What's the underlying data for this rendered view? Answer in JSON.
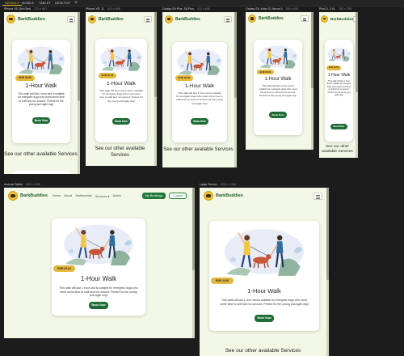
{
  "toolbar": {
    "tabs": [
      "DEFAULT",
      "MOBILE",
      "TABLET",
      "DESKTOP"
    ],
    "add_label": "+"
  },
  "site": {
    "brand": "BarkBuddies",
    "nav": {
      "home": "Home",
      "about": "About",
      "testimonials": "Testimonials",
      "services": "Services",
      "admin": "Admin",
      "bookings": "My Bookings",
      "logout": "Logout"
    },
    "card": {
      "price": "EUR 20.00",
      "title": "1-Hour Walk",
      "description": "This walk will last 1 hour and is suitable for energetic dogs who need some time to sniff and run around. Perfect for the young and agile dog!",
      "button": "Book Now"
    },
    "see_more": "See our other available Services"
  },
  "devices": [
    {
      "name": "iPhone SE (3rd Gen)",
      "size": "375 x 667"
    },
    {
      "name": "iPhone XR, 11",
      "size": "414 x 896"
    },
    {
      "name": "Galaxy S9 Plus, S8 Plus",
      "size": "412 x 846"
    },
    {
      "name": "Galaxy S5, Moto G, Nexus 5",
      "size": "360 x 640"
    },
    {
      "name": "Pixel 3, 3 XL",
      "size": "393 x 786"
    },
    {
      "name": "Android Tablet",
      "size": "800 x 1280"
    },
    {
      "name": "Large Screen",
      "size": "1024 x 1366"
    }
  ],
  "colors": {
    "page_bg": "#f3f8e6",
    "brand_green": "#1f5a2a",
    "button_green": "#1e6b35",
    "price_gold": "#e5b73b"
  }
}
